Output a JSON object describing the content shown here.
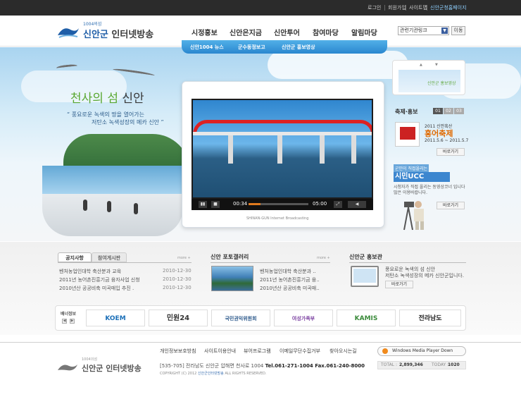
{
  "util_links": [
    "로그인",
    "회원가입",
    "사이트맵",
    "신안군청홈페이지"
  ],
  "logo": {
    "small": "1004의섬",
    "main_a": "신안군",
    "main_b": "인터넷방송"
  },
  "gnb": [
    "시정홍보",
    "신안은지금",
    "신안투어",
    "참여마당",
    "알림마당"
  ],
  "search": {
    "select": "관련기관링크",
    "go": "이동"
  },
  "subnav": [
    "신안1004 뉴스",
    "군수동정보고",
    "신안군 홍보영상"
  ],
  "hero": {
    "title_a": "천사의",
    "title_b": "섬",
    "title_c": "신안",
    "quote1": "“ 풍요로운 녹색의 땅을 열어가는",
    "quote2": "저탄소 녹색성장의 메카 신안 ”"
  },
  "player": {
    "time_current": "00:34",
    "time_total": "05:00",
    "progress": 0.2,
    "caption": "SHINAN-GUN Internet Broadcasting",
    "btn_play": "▮▮",
    "btn_stop": "■",
    "btn_full": "⤢",
    "btn_vol": "◀"
  },
  "banner_top": {
    "text": "신안군 홍보영상"
  },
  "festival": {
    "title": "축제·홍보",
    "pages": [
      "01",
      "02",
      "03"
    ],
    "year": "2011 신안흑산",
    "name": "홍어축제",
    "date": "2011.5.6 ~ 2011.5.7",
    "more": "바로가기"
  },
  "ucc": {
    "label": "군민이 직접올리는",
    "title": "시민UCC",
    "desc1": "시청자가 직접 올리는 동영상코너 입니다",
    "desc2": "많은 이용바랍니다.",
    "more": "바로가기"
  },
  "notice": {
    "tab_active": "공지사항",
    "tab_other": "참여게시판",
    "more": "more +",
    "rows": [
      {
        "title": "벤처농업인대학 축산분과 교육",
        "date": "2010-12-30"
      },
      {
        "title": "2011년 농어촌진흥기금 융자사업 신청",
        "date": "2010-12-30"
      },
      {
        "title": "2010년산 공공비축 미곡매입 추진 .",
        "date": "2010-12-30"
      }
    ]
  },
  "photo": {
    "title": "신안 포토갤러리",
    "more": "more +",
    "rows": [
      "벤처농업인대학 축산분과 ..",
      "2011년 농어촌진흥기금 융..",
      "2010년산 공공비축 미곡매.."
    ]
  },
  "pr": {
    "title": "신안군 홍보관",
    "text1": "풍요로운 녹색의 섬 신안",
    "text2": "저탄소 녹색성장의 메카 신안군입니다.",
    "more": "바로가기"
  },
  "banners": {
    "label": "배너정보",
    "prev": "◀",
    "next": "▶",
    "items": [
      "KOEM",
      "민원24",
      "국민권익위원회",
      "여성가족부",
      "KAMIS",
      "전라남도"
    ]
  },
  "footer": {
    "links": [
      "개인정보보호방침",
      "사이트이용안내",
      "뷰어프로그램",
      "이메일무단수집거부",
      "찾아오시는길"
    ],
    "logo_small": "1004의섬",
    "logo_main": "신안군 인터넷방송",
    "address_a": "[535-705] 전라남도 신안군 압해면 천사로 1004 ",
    "address_b": "Tel.061-271-1004 Fax.061-240-8000",
    "copy_a": "COPYRIGHT (C) 2012 ",
    "copy_b": "신안군인터넷방송",
    "copy_c": " ALL RIGHTS RESERVED.",
    "wmp": "Windows Media Player Down",
    "total_label": "TOTAL :",
    "total_value": "2,899,346",
    "today_label": "TODAY :",
    "today_value": "1020"
  },
  "colors": {
    "brand": "#1f5ea8",
    "subnav": "#2a87cf",
    "accent_orange": "#e06a00"
  }
}
